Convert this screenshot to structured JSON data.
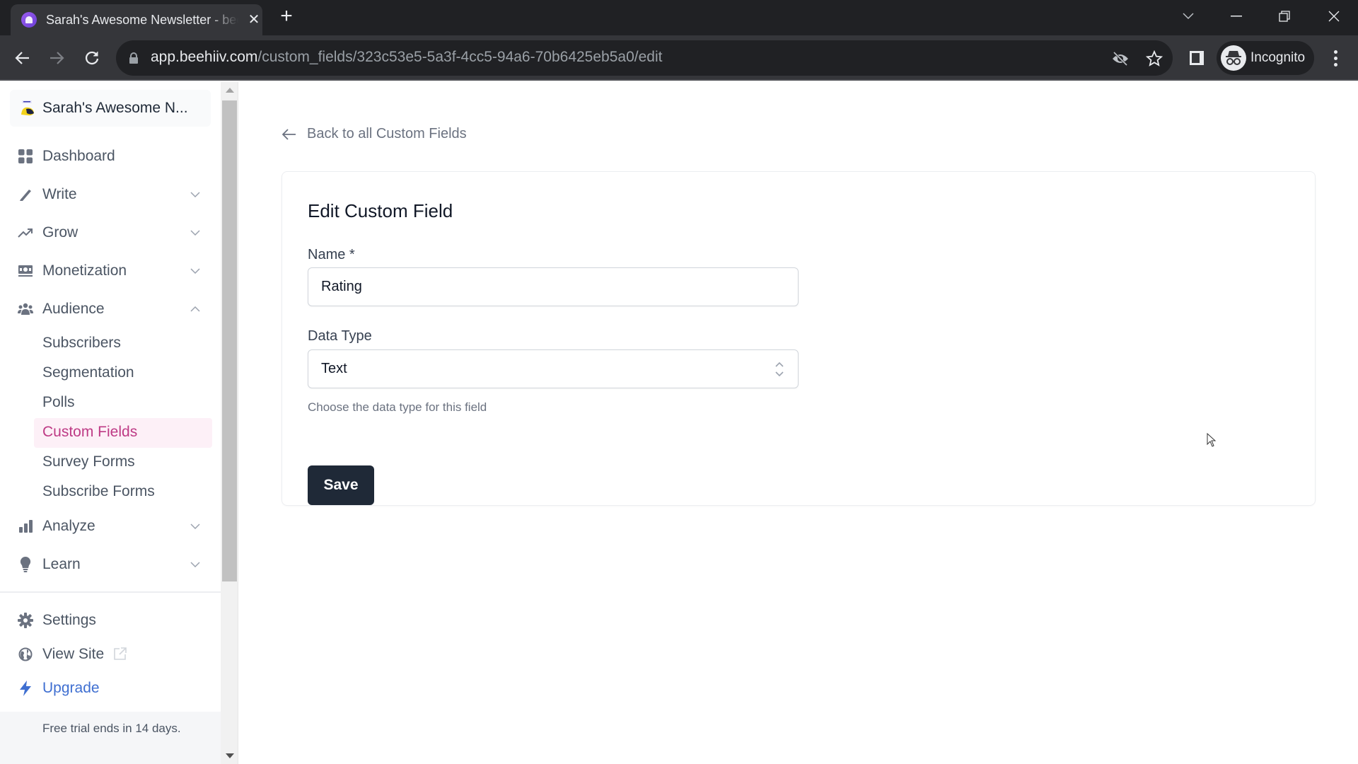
{
  "browser": {
    "tab_title": "Sarah's Awesome Newsletter - beehiiv",
    "url_host": "app.beehiiv.com",
    "url_path": "/custom_fields/323c53e5-5a3f-4cc5-94a6-70b6425eb5a0/edit",
    "profile_label": "Incognito"
  },
  "sidebar": {
    "publication_name": "Sarah's Awesome N...",
    "items": [
      {
        "label": "Dashboard",
        "icon": "dashboard-grid-icon"
      },
      {
        "label": "Write",
        "icon": "pencil-icon",
        "expandable": true
      },
      {
        "label": "Grow",
        "icon": "trending-up-icon",
        "expandable": true
      },
      {
        "label": "Monetization",
        "icon": "cash-icon",
        "expandable": true
      },
      {
        "label": "Audience",
        "icon": "users-icon",
        "expandable": true,
        "expanded": true
      },
      {
        "label": "Analyze",
        "icon": "bar-chart-icon",
        "expandable": true
      },
      {
        "label": "Learn",
        "icon": "lightbulb-icon",
        "expandable": true
      }
    ],
    "audience_subitems": [
      {
        "label": "Subscribers"
      },
      {
        "label": "Segmentation"
      },
      {
        "label": "Polls"
      },
      {
        "label": "Custom Fields",
        "active": true
      },
      {
        "label": "Survey Forms"
      },
      {
        "label": "Subscribe Forms"
      }
    ],
    "bottom_items": [
      {
        "label": "Settings",
        "icon": "gear-icon"
      },
      {
        "label": "View Site",
        "icon": "globe-icon"
      },
      {
        "label": "Upgrade",
        "icon": "lightning-icon"
      }
    ],
    "trial_notice": "Free trial ends in 14 days.",
    "active_color": "#be3a85",
    "upgrade_color": "#3f6fd1"
  },
  "main": {
    "back_link": "Back to all Custom Fields",
    "card_title": "Edit Custom Field",
    "name_label": "Name *",
    "name_value": "Rating",
    "data_type_label": "Data Type",
    "data_type_value": "Text",
    "data_type_help": "Choose the data type for this field",
    "save_label": "Save"
  }
}
